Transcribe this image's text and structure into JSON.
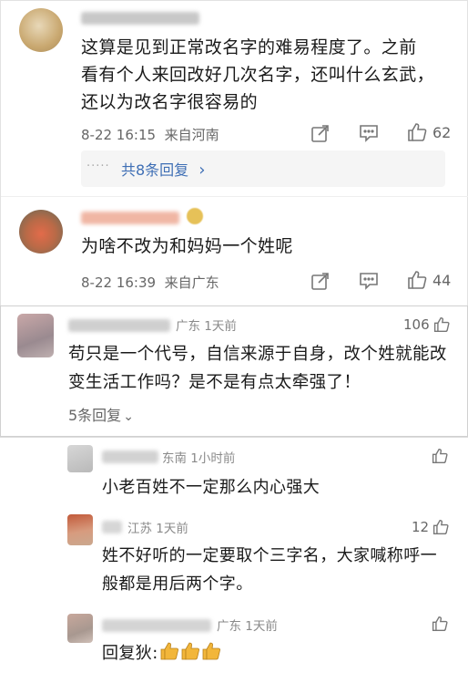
{
  "comments": [
    {
      "text": "这算是见到正常改名字的难易程度了。之前看有个人来回改好几次名字，还叫什么玄武，还以为改名字很容易的",
      "line1": "这算是见到正常改名字的难易程度了。之前",
      "line2": "看有个人来回改好几次名字，还叫什么玄武，",
      "line3": "还以为改名字很容易的",
      "time": "8-22 16:15",
      "source": "来自河南",
      "likes": "62",
      "sub_replies": "共8条回复",
      "sub_chevron": "›",
      "dots": "·····"
    },
    {
      "text": "为啥不改为和妈妈一个姓呢",
      "time": "8-22 16:39",
      "source": "来自广东",
      "likes": "44"
    },
    {
      "line1": "苟只是一个代号，自信来源于自身，改个姓就能改",
      "line2": "变生活工作吗？是不是有点太牵强了！",
      "location_time": "广东 1天前",
      "likes": "106",
      "replies": "5条回复",
      "replies_chevron": "⌄"
    }
  ],
  "sub_comments": [
    {
      "location_time": "东南 1小时前",
      "text": "小老百姓不一定那么内心强大"
    },
    {
      "location_time": "江苏 1天前",
      "likes": "12",
      "line1": "姓不好听的一定要取个三字名，大家喊称呼一",
      "line2": "般都是用后两个字。"
    },
    {
      "location_time": "广东 1天前",
      "text_prefix": "回复狄:"
    }
  ],
  "colors": {
    "link": "#3f6fb5",
    "meta": "#666666",
    "thumb_emoji": "#f2b63a"
  },
  "icons": {
    "repost": "share-square-icon",
    "comment": "comment-bubble-icon",
    "like": "thumbs-up-icon"
  }
}
